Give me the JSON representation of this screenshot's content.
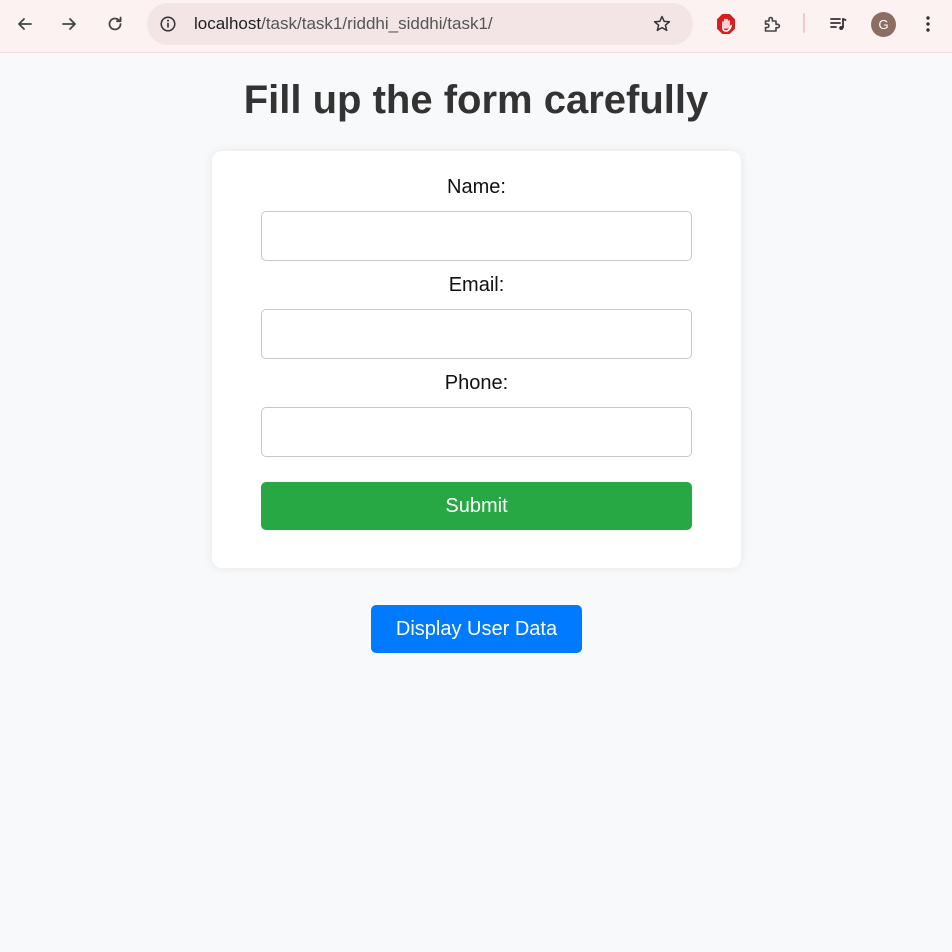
{
  "browser": {
    "url_host": "localhost",
    "url_path": "/task/task1/riddhi_siddhi/task1/",
    "profile_initial": "G",
    "icons": {
      "back": "back-arrow-icon",
      "forward": "forward-arrow-icon",
      "reload": "reload-icon",
      "site_info": "info-icon",
      "bookmark": "star-icon",
      "extension_blocker": "stop-hand-icon",
      "extensions": "puzzle-icon",
      "media": "media-queue-icon",
      "menu": "kebab-menu-icon"
    }
  },
  "page": {
    "title": "Fill up the form carefully"
  },
  "form": {
    "name_label": "Name:",
    "name_value": "",
    "email_label": "Email:",
    "email_value": "",
    "phone_label": "Phone:",
    "phone_value": "",
    "submit_label": "Submit"
  },
  "actions": {
    "display_label": "Display User Data"
  },
  "colors": {
    "submit": "#28a745",
    "display": "#007bff"
  }
}
